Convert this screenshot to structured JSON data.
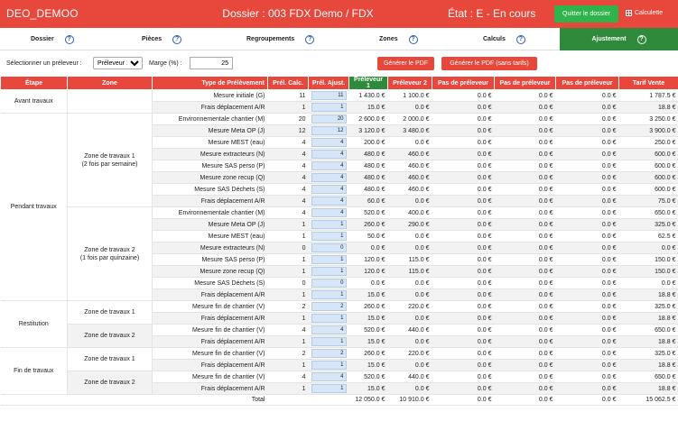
{
  "header": {
    "app_name": "DEO_DEMOO",
    "dossier": "Dossier : 003 FDX Demo  /  FDX",
    "etat": "État : E - En cours",
    "quit_label": "Quitter le dossier",
    "calc_label": "Calculette"
  },
  "tabs": [
    {
      "label": "Dossier",
      "help": "?"
    },
    {
      "label": "Pièces",
      "help": "?"
    },
    {
      "label": "Regroupements",
      "help": "?"
    },
    {
      "label": "Zones",
      "help": "?"
    },
    {
      "label": "Calculs",
      "help": "?"
    },
    {
      "label": "Ajustement",
      "help": "?"
    }
  ],
  "controls": {
    "preleveur_label": "Sélectionner un préleveur :",
    "preleveur_value": "Préleveur 1",
    "marge_label": "Marge (%) :",
    "marge_value": "25",
    "pdf_label": "Générer le PDF",
    "pdf_sans_label": "Générer le PDF (sans tarifs)"
  },
  "columns": [
    "Étape",
    "Zone",
    "Type de Prélèvement",
    "Prél. Calc.",
    "Prél. Ajust.",
    "Préleveur 1",
    "Préleveur 2",
    "Pas de préleveur",
    "Pas de préleveur",
    "Pas de préleveur",
    "Tarif Vente"
  ],
  "etapes": [
    "Avant travaux",
    "Pendant travaux",
    "Restitution",
    "Fin de travaux"
  ],
  "zones": [
    "Zone de travaux 1\n(2 fois par semaine)",
    "Zone de travaux 2\n(1 fois par quinzaine)",
    "Zone de travaux 1",
    "Zone de travaux 2",
    "Zone de travaux 1",
    "Zone de travaux 2"
  ],
  "rows": [
    [
      "Mesure initiale (G)",
      "11",
      "11",
      "1 430.0 €",
      "1 100.0 €",
      "0.0 €",
      "0.0 €",
      "0.0 €",
      "1 787.5 €"
    ],
    [
      "Frais déplacement A/R",
      "1",
      "1",
      "15.0 €",
      "0.0 €",
      "0.0 €",
      "0.0 €",
      "0.0 €",
      "18.8 €"
    ],
    [
      "Environnementale chantier (M)",
      "20",
      "20",
      "2 600.0 €",
      "2 000.0 €",
      "0.0 €",
      "0.0 €",
      "0.0 €",
      "3 250.0 €"
    ],
    [
      "Mesure Meta OP (J)",
      "12",
      "12",
      "3 120.0 €",
      "3 480.0 €",
      "0.0 €",
      "0.0 €",
      "0.0 €",
      "3 900.0 €"
    ],
    [
      "Mesure MEST (eau)",
      "4",
      "4",
      "200.0 €",
      "0.0 €",
      "0.0 €",
      "0.0 €",
      "0.0 €",
      "250.0 €"
    ],
    [
      "Mesure extracteurs (N)",
      "4",
      "4",
      "480.0 €",
      "460.0 €",
      "0.0 €",
      "0.0 €",
      "0.0 €",
      "600.0 €"
    ],
    [
      "Mesure SAS perso (P)",
      "4",
      "4",
      "480.0 €",
      "460.0 €",
      "0.0 €",
      "0.0 €",
      "0.0 €",
      "600.0 €"
    ],
    [
      "Mesure zone recup (Q)",
      "4",
      "4",
      "480.0 €",
      "460.0 €",
      "0.0 €",
      "0.0 €",
      "0.0 €",
      "600.0 €"
    ],
    [
      "Mesure SAS Déchets (S)",
      "4",
      "4",
      "480.0 €",
      "460.0 €",
      "0.0 €",
      "0.0 €",
      "0.0 €",
      "600.0 €"
    ],
    [
      "Frais déplacement A/R",
      "4",
      "4",
      "60.0 €",
      "0.0 €",
      "0.0 €",
      "0.0 €",
      "0.0 €",
      "75.0 €"
    ],
    [
      "Environnementale chantier (M)",
      "4",
      "4",
      "520.0 €",
      "400.0 €",
      "0.0 €",
      "0.0 €",
      "0.0 €",
      "650.0 €"
    ],
    [
      "Mesure Meta OP (J)",
      "1",
      "1",
      "260.0 €",
      "290.0 €",
      "0.0 €",
      "0.0 €",
      "0.0 €",
      "325.0 €"
    ],
    [
      "Mesure MEST (eau)",
      "1",
      "1",
      "50.0 €",
      "0.0 €",
      "0.0 €",
      "0.0 €",
      "0.0 €",
      "62.5 €"
    ],
    [
      "Mesure extracteurs (N)",
      "0",
      "0",
      "0.0 €",
      "0.0 €",
      "0.0 €",
      "0.0 €",
      "0.0 €",
      "0.0 €"
    ],
    [
      "Mesure SAS perso (P)",
      "1",
      "1",
      "120.0 €",
      "115.0 €",
      "0.0 €",
      "0.0 €",
      "0.0 €",
      "150.0 €"
    ],
    [
      "Mesure zone recup (Q)",
      "1",
      "1",
      "120.0 €",
      "115.0 €",
      "0.0 €",
      "0.0 €",
      "0.0 €",
      "150.0 €"
    ],
    [
      "Mesure SAS Déchets (S)",
      "0",
      "0",
      "0.0 €",
      "0.0 €",
      "0.0 €",
      "0.0 €",
      "0.0 €",
      "0.0 €"
    ],
    [
      "Frais déplacement A/R",
      "1",
      "1",
      "15.0 €",
      "0.0 €",
      "0.0 €",
      "0.0 €",
      "0.0 €",
      "18.8 €"
    ],
    [
      "Mesure fin de chantier (V)",
      "2",
      "2",
      "260.0 €",
      "220.0 €",
      "0.0 €",
      "0.0 €",
      "0.0 €",
      "325.0 €"
    ],
    [
      "Frais déplacement A/R",
      "1",
      "1",
      "15.0 €",
      "0.0 €",
      "0.0 €",
      "0.0 €",
      "0.0 €",
      "18.8 €"
    ],
    [
      "Mesure fin de chantier (V)",
      "4",
      "4",
      "520.0 €",
      "440.0 €",
      "0.0 €",
      "0.0 €",
      "0.0 €",
      "650.0 €"
    ],
    [
      "Frais déplacement A/R",
      "1",
      "1",
      "15.0 €",
      "0.0 €",
      "0.0 €",
      "0.0 €",
      "0.0 €",
      "18.8 €"
    ],
    [
      "Mesure fin de chantier (V)",
      "2",
      "2",
      "260.0 €",
      "220.0 €",
      "0.0 €",
      "0.0 €",
      "0.0 €",
      "325.0 €"
    ],
    [
      "Frais déplacement A/R",
      "1",
      "1",
      "15.0 €",
      "0.0 €",
      "0.0 €",
      "0.0 €",
      "0.0 €",
      "18.8 €"
    ],
    [
      "Mesure fin de chantier (V)",
      "4",
      "4",
      "520.0 €",
      "440.0 €",
      "0.0 €",
      "0.0 €",
      "0.0 €",
      "650.0 €"
    ],
    [
      "Frais déplacement A/R",
      "1",
      "1",
      "15.0 €",
      "0.0 €",
      "0.0 €",
      "0.0 €",
      "0.0 €",
      "18.8 €"
    ]
  ],
  "total": {
    "label": "Total",
    "values": [
      "12 050.0 €",
      "10 910.0 €",
      "0.0 €",
      "0.0 €",
      "0.0 €",
      "15 062.5 €"
    ]
  },
  "colors": {
    "primary": "#e8473c",
    "success": "#2f8a3c",
    "button_green": "#2fb34a"
  }
}
